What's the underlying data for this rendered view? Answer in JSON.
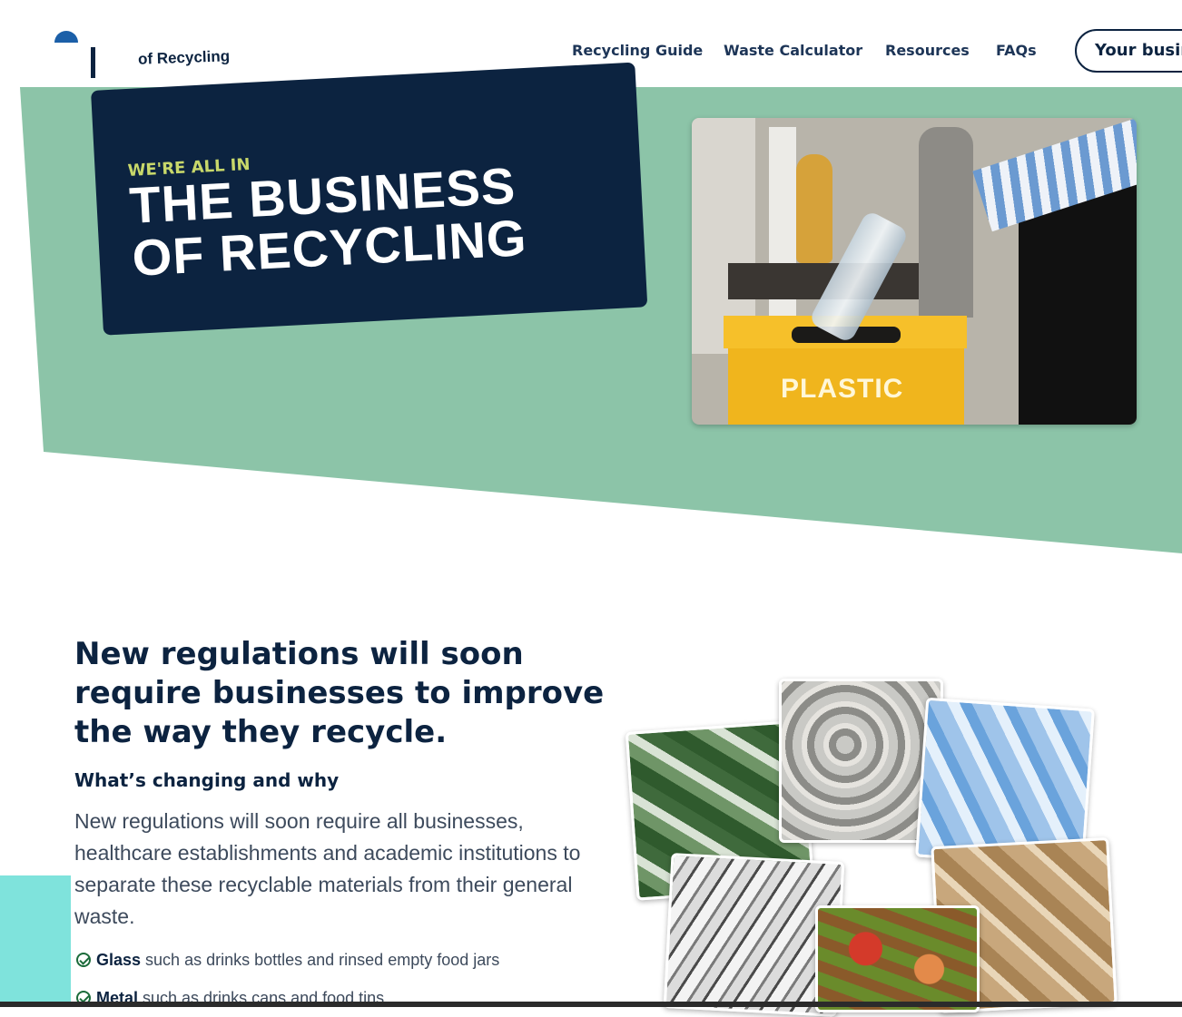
{
  "header": {
    "logo_text": "of Recycling",
    "nav": [
      "Recycling Guide",
      "Waste Calculator",
      "Resources",
      "FAQs"
    ],
    "cta_label": "Your busin"
  },
  "hero": {
    "eyebrow": "WE'RE ALL IN",
    "title": "THE BUSINESS OF RECYCLING",
    "image_label": "PLASTIC"
  },
  "section": {
    "title": "New regulations will soon require businesses to improve the way they recycle.",
    "subhead": "What’s changing and why",
    "body": "New regulations will soon require all businesses, healthcare establishments and academic institutions to separate these recyclable materials from their general waste.",
    "bullets": [
      {
        "strong": "Glass",
        "text": " such as drinks bottles and rinsed empty food jars"
      },
      {
        "strong": "Metal",
        "text": " such as drinks cans and food tins"
      }
    ]
  },
  "colors": {
    "navy": "#0c2340",
    "green": "#8cc4a8",
    "lime": "#c8d86a"
  }
}
